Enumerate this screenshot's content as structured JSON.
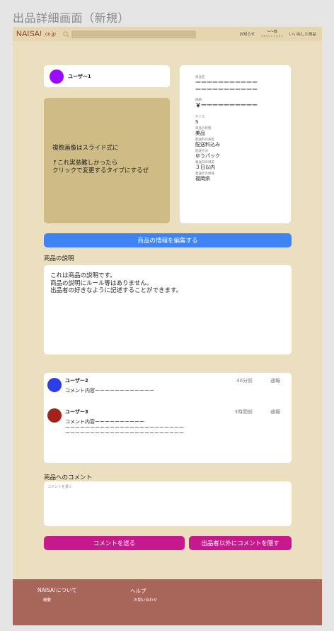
{
  "page_heading": "出品詳細画面（新規）",
  "header": {
    "logo": "NAISA!",
    "logo_sub": ".co.jp",
    "search_icon": "search-icon",
    "notice_label": "お知らせ",
    "account_name": "〜〜様",
    "account_sub": "アカウントとリスト",
    "liked_label": "いいねした商品"
  },
  "seller": {
    "name": "ユーザー1",
    "avatar_color": "#9b0cff"
  },
  "image_area": {
    "line1": "複数画像はスライド式に",
    "line2": "↑これ実装難しかったら",
    "line3": "クリックで変更するタイプにするぜ"
  },
  "info": {
    "name_label": "商品名",
    "name_line1": "ーーーーーーーーーーー",
    "name_line2": "ーーーーーーーーーーー",
    "price_label": "価格",
    "price_value": "￥ーーーーーーーーーー",
    "size_label": "サイズ",
    "size_value": "S",
    "condition_label": "商品の状態",
    "condition_value": "美品",
    "shipping_fee_label": "配送料の負担",
    "shipping_fee_value": "配送料込み",
    "method_label": "配送方法",
    "method_value": "ゆうパック",
    "days_label": "発送日の目安",
    "days_value": "３日以内",
    "origin_label": "発送元の地域",
    "origin_value": "福岡県"
  },
  "edit_button": "商品の情報を編集する",
  "description": {
    "title": "商品の説明",
    "line1": "これは商品の説明です。",
    "line2": "商品の説明にルール等はありません。",
    "line3": "出品者の好きなように記述することができます。"
  },
  "comments": [
    {
      "user": "ユーザー2",
      "time": "40分前",
      "report": "通報",
      "text": "コメント内容ーーーーーーーーーーーー",
      "avatar_color": "#2b3ee8"
    },
    {
      "user": "ユーザー3",
      "time": "3時間前",
      "report": "通報",
      "text": "コメント内容ーーーーーーーーーー\nーーーーーーーーーーーーーーーーーーーーーーーー\nーーーーーーーーーーーーーーーーーーーーーーーー",
      "avatar_color": "#a3221a"
    }
  ],
  "comment_form": {
    "title": "商品へのコメント",
    "placeholder": "コメントを書く",
    "send_button": "コメントを送る",
    "hide_button": "出品者以外にコメントを隠す"
  },
  "footer": {
    "about_title": "NAISA!について",
    "about_link": "概要",
    "help_title": "ヘルプ",
    "contact_link": "お問い合わせ"
  },
  "colors": {
    "background": "#ecdfc0",
    "edit_button": "#3e84f5",
    "action_button": "#c7198e",
    "footer": "#a8665a"
  }
}
